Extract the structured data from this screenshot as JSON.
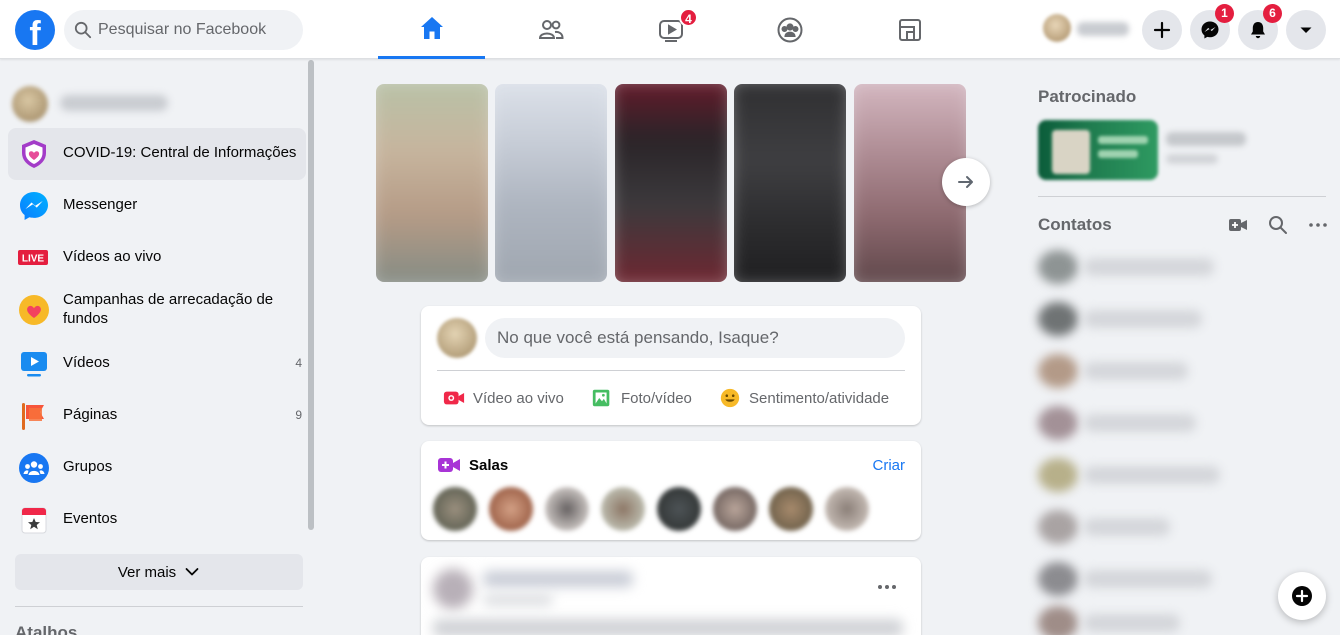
{
  "colors": {
    "brand": "#1877f2",
    "badge": "#e41e3f",
    "background": "#f0f2f5"
  },
  "header": {
    "logo_letter": "f",
    "search_placeholder": "Pesquisar no Facebook",
    "nav_tabs": [
      {
        "icon": "home-icon",
        "active": true
      },
      {
        "icon": "friends-icon",
        "active": false
      },
      {
        "icon": "watch-icon",
        "active": false,
        "badge": "4"
      },
      {
        "icon": "groups-icon",
        "active": false
      },
      {
        "icon": "gaming-icon",
        "active": false
      }
    ],
    "create_icon": "plus-icon",
    "messenger_badge": "1",
    "notifications_badge": "6",
    "account_icon": "chevron-down-icon"
  },
  "sidebar": {
    "items": [
      {
        "label": "COVID-19: Central de Informações",
        "icon": "covid-shield-icon",
        "active": true
      },
      {
        "label": "Messenger",
        "icon": "messenger-icon"
      },
      {
        "label": "Vídeos ao vivo",
        "icon": "live-icon",
        "icon_text": "LIVE"
      },
      {
        "label": "Campanhas de arrecadação de fundos",
        "icon": "fundraiser-heart-icon"
      },
      {
        "label": "Vídeos",
        "icon": "video-play-icon",
        "count": "4"
      },
      {
        "label": "Páginas",
        "icon": "pages-flag-icon",
        "count": "9"
      },
      {
        "label": "Grupos",
        "icon": "groups-icon"
      },
      {
        "label": "Eventos",
        "icon": "events-calendar-icon"
      }
    ],
    "see_more": "Ver mais",
    "shortcuts_title": "Atalhos"
  },
  "composer": {
    "placeholder": "No que você está pensando, Isaque?",
    "actions": [
      {
        "label": "Vídeo ao vivo",
        "icon": "live-video-icon",
        "color": "#f02849"
      },
      {
        "label": "Foto/vídeo",
        "icon": "photo-icon",
        "color": "#45bd62"
      },
      {
        "label": "Sentimento/atividade",
        "icon": "feeling-icon",
        "color": "#f7b928"
      }
    ]
  },
  "rooms": {
    "title": "Salas",
    "create": "Criar"
  },
  "right": {
    "sponsored_title": "Patrocinado",
    "contacts_title": "Contatos"
  }
}
